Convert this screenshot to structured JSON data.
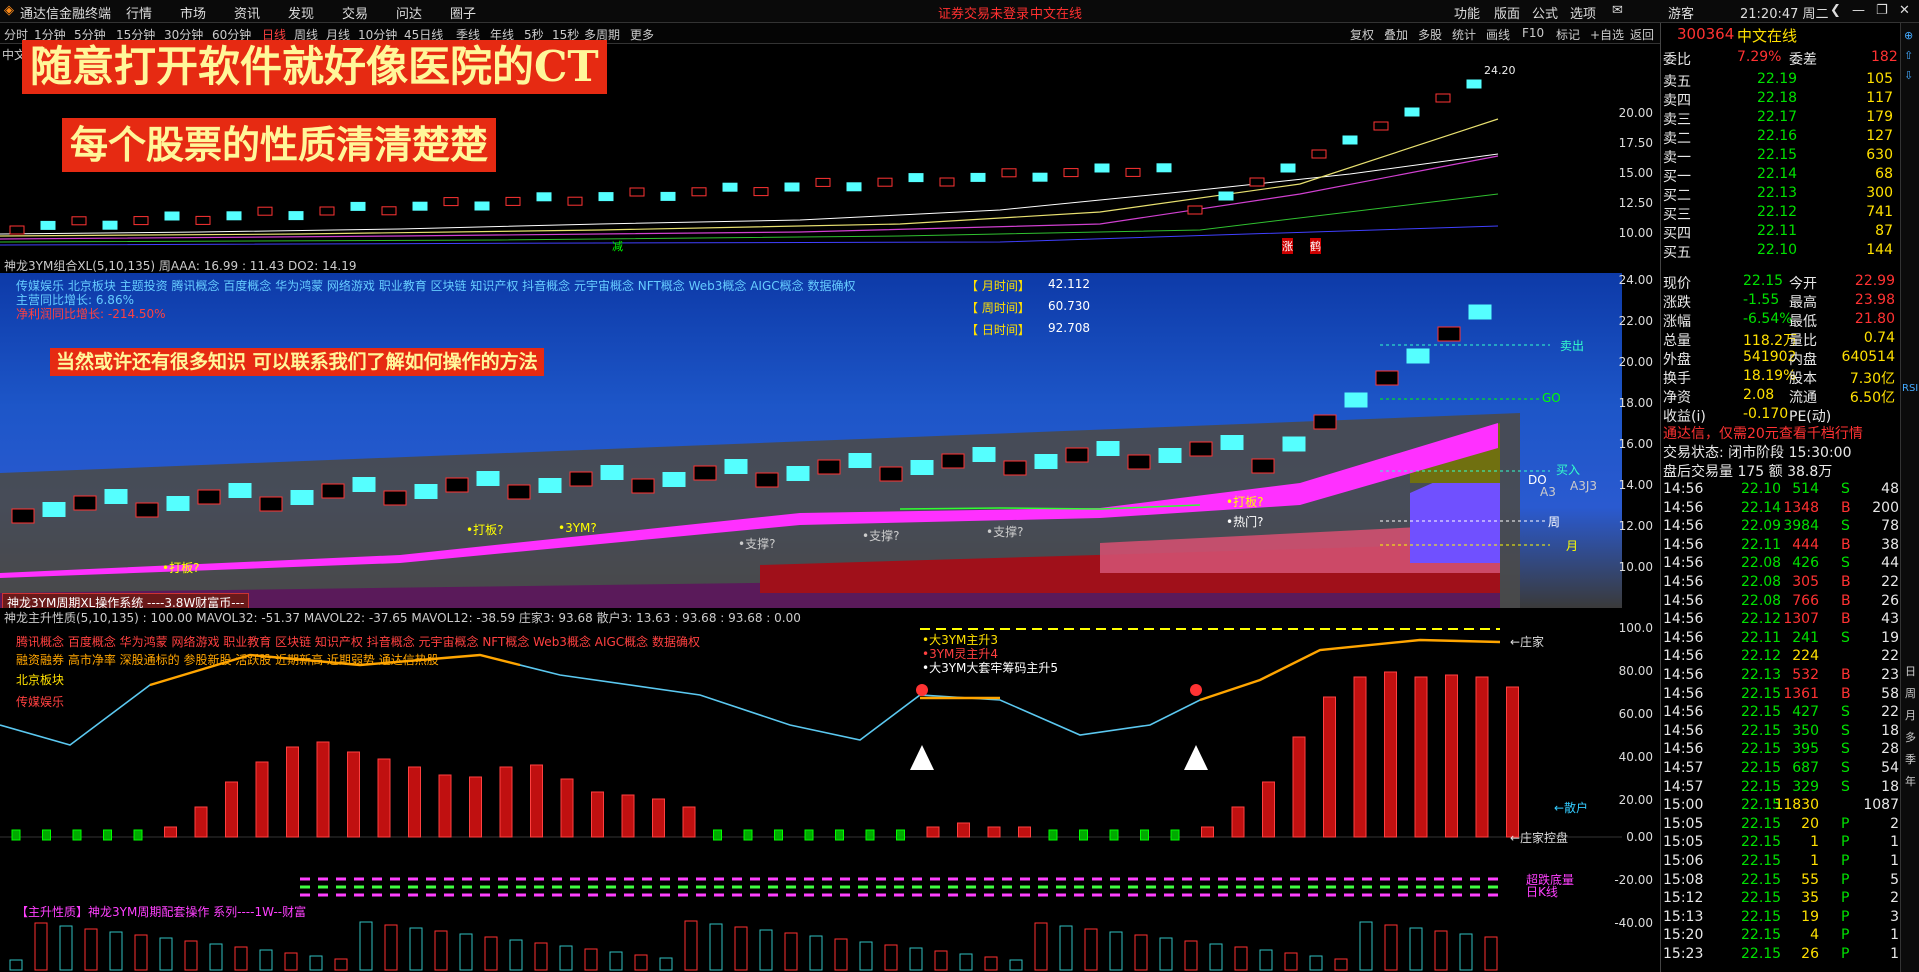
{
  "app": {
    "name": "通达信金融终端",
    "menus": [
      "行情",
      "市场",
      "资讯",
      "发现",
      "交易",
      "问达",
      "圈子"
    ],
    "trade_status": "证券交易未登录",
    "stock_title": "中文在线",
    "right_menus": [
      "功能",
      "版面",
      "公式",
      "选项"
    ],
    "user": "游客",
    "clock": "21:20:47 周二"
  },
  "periods": [
    "分时",
    "1分钟",
    "5分钟",
    "15分钟",
    "30分钟",
    "60分钟",
    "日线",
    "周线",
    "月线",
    "10分钟",
    "45日线",
    "季线",
    "年线",
    "5秒",
    "15秒",
    "多周期",
    "更多"
  ],
  "tools": [
    "复权",
    "叠加",
    "多股",
    "统计",
    "画线",
    "F10",
    "标记",
    "+自选",
    "返回"
  ],
  "banners": {
    "b1": "随意打开软件就好像医院的CT",
    "b2": "每个股票的性质清清楚楚",
    "b3": "当然或许还有很多知识  可以联系我们了解如何操作的方法"
  },
  "pane1": {
    "name": "中文",
    "price_label": "24.20",
    "yticks": [
      "20.00",
      "17.50",
      "15.00",
      "12.50",
      "10.00"
    ],
    "marks": [
      "减",
      "涨",
      "鹤"
    ]
  },
  "pane2": {
    "header": "神龙3YM组合XL(5,10,135)  周AAA: 16.99 : 11.43  DO2: 14.19",
    "concepts": "传媒娱乐 北京板块 主题投资 腾讯概念 百度概念 华为鸿蒙 网络游戏 职业教育 区块链 知识产权 抖音概念 元宇宙概念 NFT概念 Web3概念 AIGC概念 数据确权",
    "growth1": "主营同比增长: 6.86%",
    "growth2": "净利润同比增长: -214.50%",
    "month_time": "【 月时间】",
    "week_time": "【 周时间】",
    "day_time": "【 日时间】",
    "month_val": "42.112",
    "week_val": "60.730",
    "day_val": "92.708",
    "labels": [
      "卖出",
      "GO",
      "买入",
      "DO",
      "A3",
      "A3J3",
      "周",
      "月"
    ],
    "tips": [
      "•打板?",
      "•打板?",
      "•3YM?",
      "•支撑?",
      "•支撑?",
      "•支撑?",
      "•打板?",
      "•热门?"
    ],
    "footer": "神龙3YM周期XL操作系统 ----3.8W财富币---",
    "yticks": [
      "24.00",
      "22.00",
      "20.00",
      "18.00",
      "16.00",
      "14.00",
      "12.00",
      "10.00"
    ]
  },
  "pane3": {
    "header": "神龙主升性质(5,10,135) : 100.00  MAVOL32: -51.37  MAVOL22: -37.65  MAVOL12: -38.59  庄家3: 93.68  散户3: 13.63 : 93.68 : 93.68 : 0.00",
    "concepts": "腾讯概念 百度概念 华为鸿蒙 网络游戏 职业教育 区块链 知识产权 抖音概念 元宇宙概念 NFT概念 Web3概念 AIGC概念 数据确权",
    "concepts2": "融资融券 高市净率 深股通标的 参股新股 活跃股 近期新高 近期弱势 通达信热股",
    "bk1": "北京板块",
    "bk2": "传媒娱乐",
    "notes": [
      "•大3YM主升3",
      "•3YM灵主升4",
      "•大3YM大套牢筹码主升5"
    ],
    "right_labels": [
      "←庄家",
      "←散户",
      "←庄家控盘",
      "超跌底量",
      "日K线"
    ],
    "bottom": "【主升性质】神龙3YM周期配套操作 系列----1W--财富",
    "yticks": [
      "100.0",
      "80.00",
      "60.00",
      "40.00",
      "20.00",
      "0.00",
      "-20.00",
      "-40.00"
    ]
  },
  "quote": {
    "code": "300364",
    "name": "中文在线",
    "weibi_label": "委比",
    "weibi": "7.29%",
    "weicha_label": "委差",
    "weicha": "182",
    "asks": [
      {
        "l": "卖五",
        "p": "22.19",
        "v": "105"
      },
      {
        "l": "卖四",
        "p": "22.18",
        "v": "117"
      },
      {
        "l": "卖三",
        "p": "22.17",
        "v": "179"
      },
      {
        "l": "卖二",
        "p": "22.16",
        "v": "127"
      },
      {
        "l": "卖一",
        "p": "22.15",
        "v": "630"
      }
    ],
    "bids": [
      {
        "l": "买一",
        "p": "22.14",
        "v": "68"
      },
      {
        "l": "买二",
        "p": "22.13",
        "v": "300"
      },
      {
        "l": "买三",
        "p": "22.12",
        "v": "741"
      },
      {
        "l": "买四",
        "p": "22.11",
        "v": "87"
      },
      {
        "l": "买五",
        "p": "22.10",
        "v": "144"
      }
    ],
    "stats": [
      {
        "a": "现价",
        "b": "22.15",
        "c": "今开",
        "d": "22.99"
      },
      {
        "a": "涨跌",
        "b": "-1.55",
        "c": "最高",
        "d": "23.98"
      },
      {
        "a": "涨幅",
        "b": "-6.54%",
        "c": "最低",
        "d": "21.80"
      },
      {
        "a": "总量",
        "b": "118.2万",
        "c": "量比",
        "d": "0.74"
      },
      {
        "a": "外盘",
        "b": "541902",
        "c": "内盘",
        "d": "640514"
      },
      {
        "a": "换手",
        "b": "18.19%",
        "c": "股本",
        "d": "7.30亿"
      },
      {
        "a": "净资",
        "b": "2.08",
        "c": "流通",
        "d": "6.50亿"
      },
      {
        "a": "收益(i)",
        "b": "-0.170",
        "c": "PE(动)",
        "d": ""
      }
    ],
    "ad": "通达信，仅需20元查看千档行情",
    "status": "交易状态: 闭市阶段 15:30:00",
    "after": "盘后交易量 175 额 38.8万",
    "ticks": [
      [
        "14:56",
        "22.10",
        "514",
        "S",
        "48"
      ],
      [
        "14:56",
        "22.14",
        "1348",
        "B",
        "200"
      ],
      [
        "14:56",
        "22.09",
        "3984",
        "S",
        "78"
      ],
      [
        "14:56",
        "22.11",
        "444",
        "B",
        "38"
      ],
      [
        "14:56",
        "22.08",
        "426",
        "S",
        "44"
      ],
      [
        "14:56",
        "22.08",
        "305",
        "B",
        "22"
      ],
      [
        "14:56",
        "22.08",
        "766",
        "B",
        "26"
      ],
      [
        "14:56",
        "22.12",
        "1307",
        "B",
        "43"
      ],
      [
        "14:56",
        "22.11",
        "241",
        "S",
        "19"
      ],
      [
        "14:56",
        "22.12",
        "224",
        "",
        "22"
      ],
      [
        "14:56",
        "22.13",
        "532",
        "B",
        "23"
      ],
      [
        "14:56",
        "22.15",
        "1361",
        "B",
        "58"
      ],
      [
        "14:56",
        "22.15",
        "427",
        "S",
        "22"
      ],
      [
        "14:56",
        "22.15",
        "350",
        "S",
        "18"
      ],
      [
        "14:56",
        "22.15",
        "395",
        "S",
        "28"
      ],
      [
        "14:57",
        "22.15",
        "687",
        "S",
        "54"
      ],
      [
        "14:57",
        "22.15",
        "329",
        "S",
        "18"
      ],
      [
        "15:00",
        "22.15",
        "11830",
        "",
        "1087"
      ],
      [
        "15:05",
        "22.15",
        "20",
        "P",
        "2"
      ],
      [
        "15:05",
        "22.15",
        "1",
        "P",
        "1"
      ],
      [
        "15:06",
        "22.15",
        "1",
        "P",
        "1"
      ],
      [
        "15:08",
        "22.15",
        "55",
        "P",
        "5"
      ],
      [
        "15:12",
        "22.15",
        "35",
        "P",
        "2"
      ],
      [
        "15:13",
        "22.15",
        "19",
        "P",
        "3"
      ],
      [
        "15:20",
        "22.15",
        "4",
        "P",
        "1"
      ],
      [
        "15:23",
        "22.15",
        "26",
        "P",
        "1"
      ]
    ]
  },
  "rtabs": [
    "RSI",
    "日",
    "周",
    "月",
    "多",
    "季",
    "年"
  ]
}
